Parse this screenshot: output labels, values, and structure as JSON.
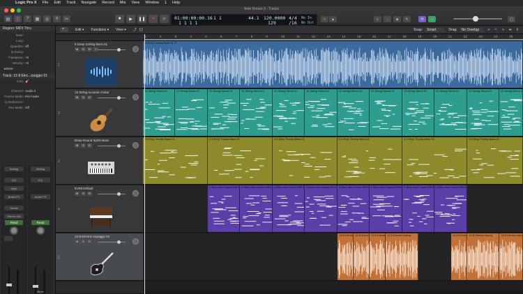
{
  "menubar": {
    "items": [
      "Logic Pro X",
      "File",
      "Edit",
      "Track",
      "Navigate",
      "Record",
      "Mix",
      "View",
      "Window",
      "1",
      "Help"
    ]
  },
  "window": {
    "title": "Ante Dream 2 - Tracks"
  },
  "lcd": {
    "position": "01:00:00:00.16",
    "bars": "1  1  1  1",
    "beats_small": "1  1",
    "key": "44.1",
    "tempo": "120.0000",
    "sig": "4/4",
    "sig_sub": "/16",
    "beat": "129",
    "in": "No In",
    "out": "No Out"
  },
  "inspector": {
    "region_header": "Region: MIDI Thru",
    "region_params": [
      [
        "Mute:",
        ""
      ],
      [
        "Loop:",
        ""
      ],
      [
        "Quantize:",
        "off"
      ],
      [
        "Q-Swing:",
        ""
      ],
      [
        "Transpose:",
        "+0"
      ],
      [
        "Velocity:",
        "+0"
      ]
    ],
    "more": "More",
    "track_header": "Track: 12-8 Elec...rpeggio 01",
    "track_params": [
      [
        "Icon:",
        ""
      ],
      [
        "Channel:",
        "Audio 2"
      ],
      [
        "Freeze Mode:",
        "Pre Fader"
      ],
      [
        "Q-Reference:",
        ""
      ],
      [
        "Flex Mode:",
        "Off"
      ]
    ],
    "strip_labels": [
      "Setting",
      "EQ",
      "Input",
      "Audio FX",
      "Sends",
      "Stereo Out",
      "Read"
    ],
    "strip2_labels": [
      "Setting",
      "EQ",
      "Audio FX",
      "Read"
    ],
    "strip_names": [
      "",
      "Bnce"
    ]
  },
  "toolbar": {
    "edit": "Edit",
    "functions": "Functions",
    "view": "View",
    "snap_label": "Snap:",
    "snap_value": "Smart",
    "drag_label": "Drag:",
    "drag_value": "No Overlap"
  },
  "ruler": {
    "ticks": [
      "1",
      "2",
      "3",
      "4",
      "5",
      "6",
      "7",
      "8",
      "9",
      "10",
      "11",
      "12",
      "13",
      "14",
      "15",
      "16",
      "17",
      "18",
      "19",
      "20",
      "21",
      "22",
      "23",
      "24",
      "25"
    ]
  },
  "tracks": [
    {
      "num": "1",
      "name": "5 Deep Ceiling Bass 01",
      "icon": "waveform-icon"
    },
    {
      "num": "2",
      "name": "12 String Acoustic Guitar",
      "icon": "acoustic-guitar-icon"
    },
    {
      "num": "3",
      "name": "Deep Round Synth Bass",
      "icon": "synth-module-icon"
    },
    {
      "num": "4",
      "name": "EV88 Default",
      "icon": "electric-piano-icon"
    },
    {
      "num": "5",
      "name": "12-8 Electric Arpeggio 01",
      "icon": "electric-guitar-icon"
    }
  ],
  "regions": {
    "lane1": [
      {
        "name": "5 Deep Ceiling Bass 01",
        "loop": "⟳"
      }
    ],
    "lane2": [
      "12 String Strum 01",
      "12 String Strum 01",
      "12 String Strum 01",
      "12 String Strum 01",
      "12 String Strum 01",
      "12 String Strum 01",
      "12 String Strum 01",
      "12 String Strum 01",
      "12 String Strum 01",
      "12 String Strum 01",
      "12 String Strum 01",
      "12 String Strum 01"
    ],
    "lane3": [
      "2.5 Step Thump Bass 01",
      "2.5 Step Thump Bass 01",
      "2.5 Step Thump Bass 01",
      "2.5 Step Thump Bass 01",
      "2.5 Step Thump Bass 01",
      "2.5 Step Thump Bass 01"
    ],
    "lane4": [
      "2 Blue Jazz Organ Riff 02",
      "2 Blue Jazz Organ Riff 02",
      "2 Blue Jazz Organ Riff 02",
      "2 Blue Jazz Organ Riff 02",
      "2 Blue Jazz Organ Riff 02",
      "2 Blue Jazz Organ Riff 02",
      "2 Blue Jazz Organ Riff 02",
      "2 Blue Jazz Organ Riff 02"
    ],
    "lane5": [
      "12-8 Electric Arpeg",
      "12-8 Electric Arpeg",
      "12-8 Electric Arpeg",
      "12-8 Electric Arpeg"
    ]
  }
}
